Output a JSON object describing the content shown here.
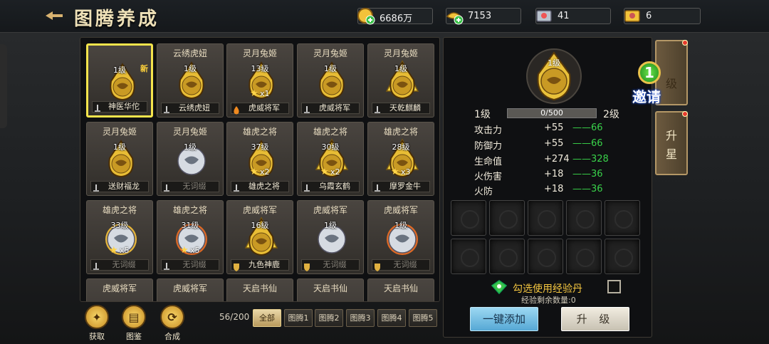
{
  "header": {
    "title": "图腾养成",
    "resources": [
      {
        "icon": "gold-coin-icon",
        "value": "6686万"
      },
      {
        "icon": "gold-ingot-icon",
        "value": "7153"
      },
      {
        "icon": "silver-ticket-icon",
        "value": "41"
      },
      {
        "icon": "gold-ticket-icon",
        "value": "6"
      }
    ]
  },
  "grid": {
    "cards": [
      {
        "name": "",
        "level": "1级",
        "tag": "新",
        "bar": "神医华佗",
        "bar_icon": "sword",
        "emb": "gold",
        "selected": true
      },
      {
        "name": "云绣虎妞",
        "level": "1级",
        "bar": "云绣虎妞",
        "bar_icon": "sword",
        "emb": "gold"
      },
      {
        "name": "灵月兔姬",
        "level": "13级",
        "stars": "x1",
        "bar": "虎威将军",
        "bar_icon": "flame",
        "emb": "gold"
      },
      {
        "name": "灵月兔姬",
        "level": "1级",
        "bar": "虎威将军",
        "bar_icon": "sword",
        "emb": "gold"
      },
      {
        "name": "灵月兔姬",
        "level": "1级",
        "bar": "天乾麒麟",
        "bar_icon": "sword",
        "emb": "gold-tri"
      },
      {
        "name": "灵月兔姬",
        "level": "1级",
        "bar": "送财福龙",
        "bar_icon": "sword",
        "emb": "gold"
      },
      {
        "name": "灵月兔姬",
        "level": "1级",
        "bar": "无词缀",
        "bar_icon": "sword",
        "emb": "silver",
        "dim": true
      },
      {
        "name": "雄虎之将",
        "level": "37级",
        "stars": "x2",
        "bar": "雄虎之将",
        "bar_icon": "sword",
        "emb": "gold"
      },
      {
        "name": "雄虎之将",
        "level": "30级",
        "stars": "x2",
        "bar": "乌霞玄鹤",
        "bar_icon": "sword",
        "emb": "gold-tri"
      },
      {
        "name": "雄虎之将",
        "level": "28级",
        "stars": "x3",
        "bar": "摩罗金牛",
        "bar_icon": "sword",
        "emb": "gold-tri"
      },
      {
        "name": "雄虎之将",
        "level": "33级",
        "stars": "x5",
        "bar": "无词缀",
        "bar_icon": "sword",
        "emb": "silver-gold",
        "dim": true
      },
      {
        "name": "雄虎之将",
        "level": "31级",
        "stars": "x5",
        "bar": "无词缀",
        "bar_icon": "sword",
        "emb": "silver-orange",
        "dim": true
      },
      {
        "name": "虎威将军",
        "level": "16级",
        "bar": "九色神鹿",
        "bar_icon": "shield",
        "emb": "gold-tri"
      },
      {
        "name": "虎威将军",
        "level": "1级",
        "bar": "无词缀",
        "bar_icon": "shield",
        "emb": "silver",
        "dim": true
      },
      {
        "name": "虎威将军",
        "level": "1级",
        "bar": "无词缀",
        "bar_icon": "shield",
        "emb": "silver-orange",
        "dim": true
      },
      {
        "name": "虎威将军"
      },
      {
        "name": "虎威将军"
      },
      {
        "name": "天启书仙"
      },
      {
        "name": "天启书仙"
      },
      {
        "name": "天启书仙"
      }
    ]
  },
  "bottom": {
    "buttons": [
      {
        "icon": "gain-icon",
        "label": "获取"
      },
      {
        "icon": "catalog-icon",
        "label": "图鉴"
      },
      {
        "icon": "compose-icon",
        "label": "合成"
      }
    ],
    "count": "56/200",
    "tabs": [
      "全部",
      "图腾1",
      "图腾2",
      "图腾3",
      "图腾4",
      "图腾5"
    ]
  },
  "detail": {
    "big_level": "1级",
    "level_from": "1级",
    "level_to": "2级",
    "xp_text": "0/500",
    "xp_fraction": 0,
    "stats": [
      {
        "label": "攻击力",
        "value": "+55",
        "next": "66"
      },
      {
        "label": "防御力",
        "value": "+55",
        "next": "66"
      },
      {
        "label": "生命值",
        "value": "+274",
        "next": "328"
      },
      {
        "label": "火伤害",
        "value": "+18",
        "next": "36"
      },
      {
        "label": "火防",
        "value": "+18",
        "next": "36"
      }
    ],
    "use_xp_label": "勾选使用经验丹",
    "remain_label": "经验剩余数量:0",
    "add_all": "一键添加",
    "upgrade": "升 级"
  },
  "side": {
    "tab1": "级",
    "tab2": "升星",
    "invite_num": "1",
    "invite": "邀请"
  }
}
